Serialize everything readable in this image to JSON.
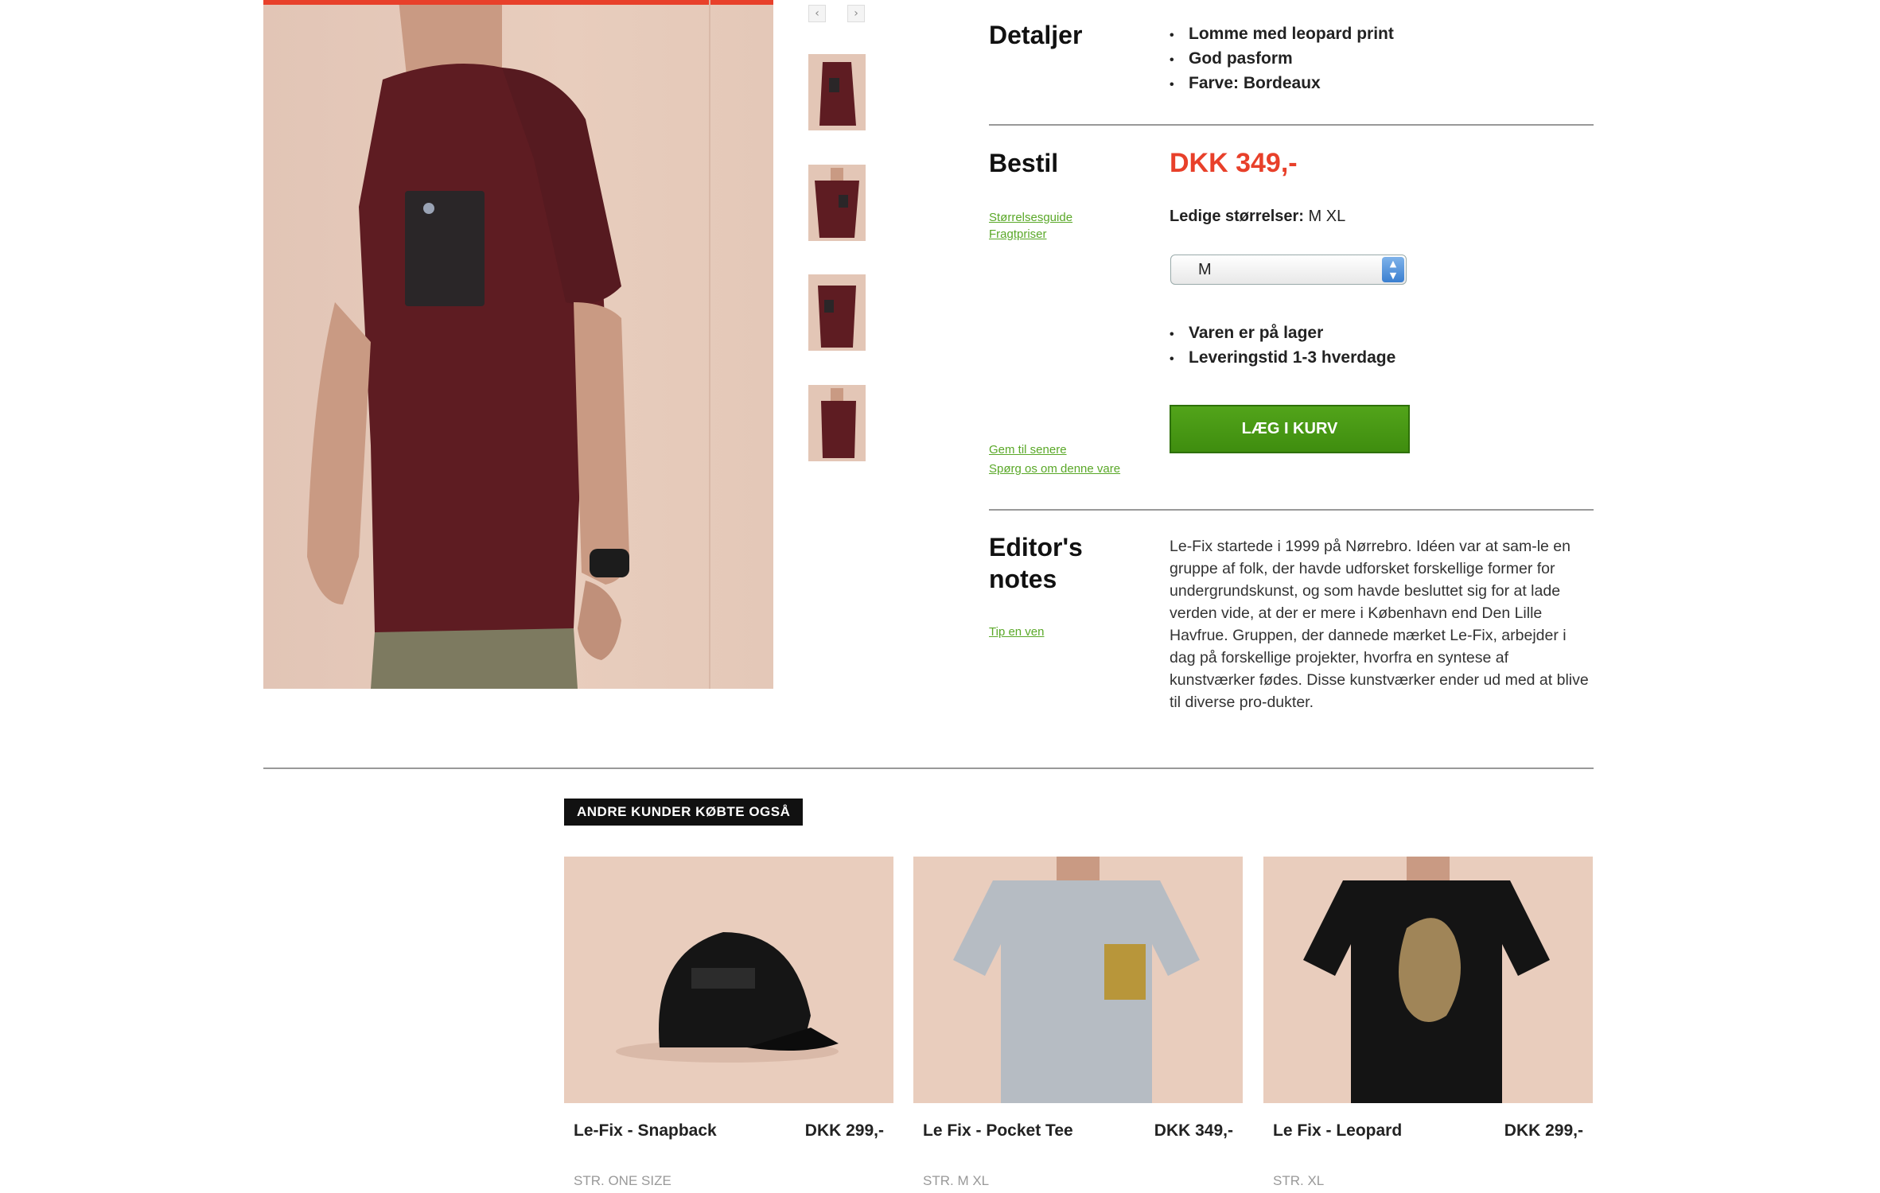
{
  "gallery": {
    "prev_symbol": "‹",
    "next_symbol": "›"
  },
  "details": {
    "title": "Detaljer",
    "items": [
      "Lomme med leopard print",
      "God pasform",
      "Farve: Bordeaux"
    ]
  },
  "order": {
    "title": "Bestil",
    "price": "DKK 349,-",
    "sizes_label": "Ledige størrelser:",
    "sizes_value": "M XL",
    "size_guide_link": "Størrelsesguide",
    "shipping_link": "Fragtpriser",
    "selected_size": "M",
    "select_arrows": "▲\n▼",
    "stock_items": [
      "Varen er på lager",
      "Leveringstid 1-3 hverdage"
    ],
    "add_to_cart": "LÆG I KURV",
    "save_link": "Gem til senere",
    "ask_link": "Spørg os om denne vare"
  },
  "editor": {
    "title": "Editor's notes",
    "tip_link": "Tip en ven",
    "text": "Le-Fix startede i 1999 på Nørrebro. Idéen var at sam-le en gruppe af folk, der havde udforsket forskellige former for undergrundskunst, og som havde besluttet sig for at lade verden vide, at der er mere i København end Den Lille Havfrue. Gruppen, der dannede mærket Le-Fix, arbejder i dag på forskellige projekter, hvorfra en syntese af kunstværker fødes. Disse kunstværker ender ud med at blive til diverse pro-dukter."
  },
  "also_bought": {
    "title": "ANDRE KUNDER KØBTE OGSÅ",
    "products": [
      {
        "name": "Le-Fix - Snapback",
        "price": "DKK 299,-",
        "size": "STR. ONE SIZE"
      },
      {
        "name": "Le Fix - Pocket Tee",
        "price": "DKK 349,-",
        "size": "STR. M XL"
      },
      {
        "name": "Le Fix - Leopard",
        "price": "DKK 299,-",
        "size": "STR. XL"
      }
    ]
  },
  "colors": {
    "accent_red": "#e8402a",
    "link_green": "#5aa828",
    "button_green": "#4a9a16",
    "shirt_bordeaux": "#5e1c22"
  }
}
